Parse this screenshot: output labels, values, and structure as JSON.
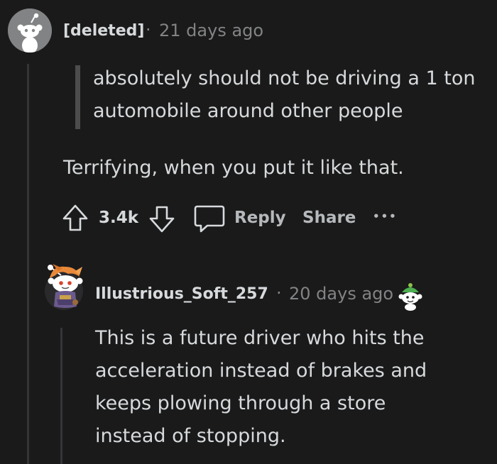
{
  "parent_comment": {
    "author": "[deleted]",
    "separator": "·",
    "timestamp": "21 days ago",
    "quote": "absolutely should not be driving a 1 ton automobile around other people",
    "body": "Terrifying, when you put it like that.",
    "score": "3.4k",
    "reply_label": "Reply",
    "share_label": "Share",
    "more_label": "•••"
  },
  "reply_comment": {
    "author": "Illustrious_Soft_257",
    "separator": "·",
    "timestamp": "20 days ago",
    "body_lines": [
      "This is a future driver who hits the",
      "acceleration instead of brakes and",
      "keeps plowing through a store",
      "instead of stopping."
    ]
  },
  "colors": {
    "background": "#1a1a1b",
    "text": "#d7dadc",
    "muted": "#818384",
    "thread_line": "#343536"
  }
}
